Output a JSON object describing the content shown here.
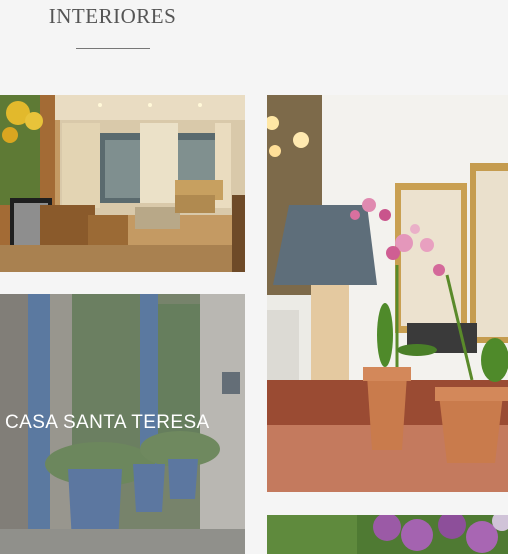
{
  "section": {
    "title": "INTERIORES"
  },
  "gallery": {
    "items": [
      {
        "id": "living-room",
        "caption": ""
      },
      {
        "id": "orchids",
        "caption": ""
      },
      {
        "id": "santa-teresa",
        "caption": "CASA SANTA TERESA"
      },
      {
        "id": "garden",
        "caption": ""
      }
    ]
  },
  "colors": {
    "background": "#f5f5f5",
    "heading": "#555555",
    "caption": "#ffffff"
  }
}
